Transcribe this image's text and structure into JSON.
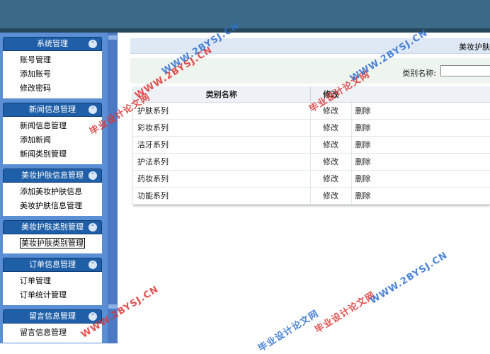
{
  "sidebar": {
    "groups": [
      {
        "title": "系统管理",
        "items": [
          "账号管理",
          "添加账号",
          "修改密码"
        ]
      },
      {
        "title": "新闻信息管理",
        "items": [
          "新闻信息管理",
          "添加新闻",
          "新闻类别管理"
        ]
      },
      {
        "title": "美妆护肤信息管理",
        "items": [
          "添加美妆护肤信息",
          "美妆护肤信息管理"
        ]
      },
      {
        "title": "美妆护肤类别管理",
        "items": [
          "美妆护肤类别管理"
        ]
      },
      {
        "title": "订单信息管理",
        "items": [
          "订单管理",
          "订单统计管理"
        ]
      },
      {
        "title": "留言信息管理",
        "items": [
          "留言信息管理"
        ]
      }
    ],
    "collapse_glyph": "⌃"
  },
  "content": {
    "header_title": "美妆护肤",
    "search_label": "类别名称:",
    "search_value": ""
  },
  "table": {
    "headers": [
      "类别名称",
      "修改",
      ""
    ],
    "rows": [
      {
        "name": "护肤系列",
        "edit": "修改",
        "delete": "删除"
      },
      {
        "name": "彩妆系列",
        "edit": "修改",
        "delete": "删除"
      },
      {
        "name": "洁牙系列",
        "edit": "修改",
        "delete": "删除"
      },
      {
        "name": "护法系列",
        "edit": "修改",
        "delete": "删除"
      },
      {
        "name": "药妆系列",
        "edit": "修改",
        "delete": "删除"
      },
      {
        "name": "功能系列",
        "edit": "修改",
        "delete": "删除"
      }
    ]
  },
  "watermarks": [
    "毕业设计论文网",
    "WWW.2BYSJ.CN"
  ]
}
